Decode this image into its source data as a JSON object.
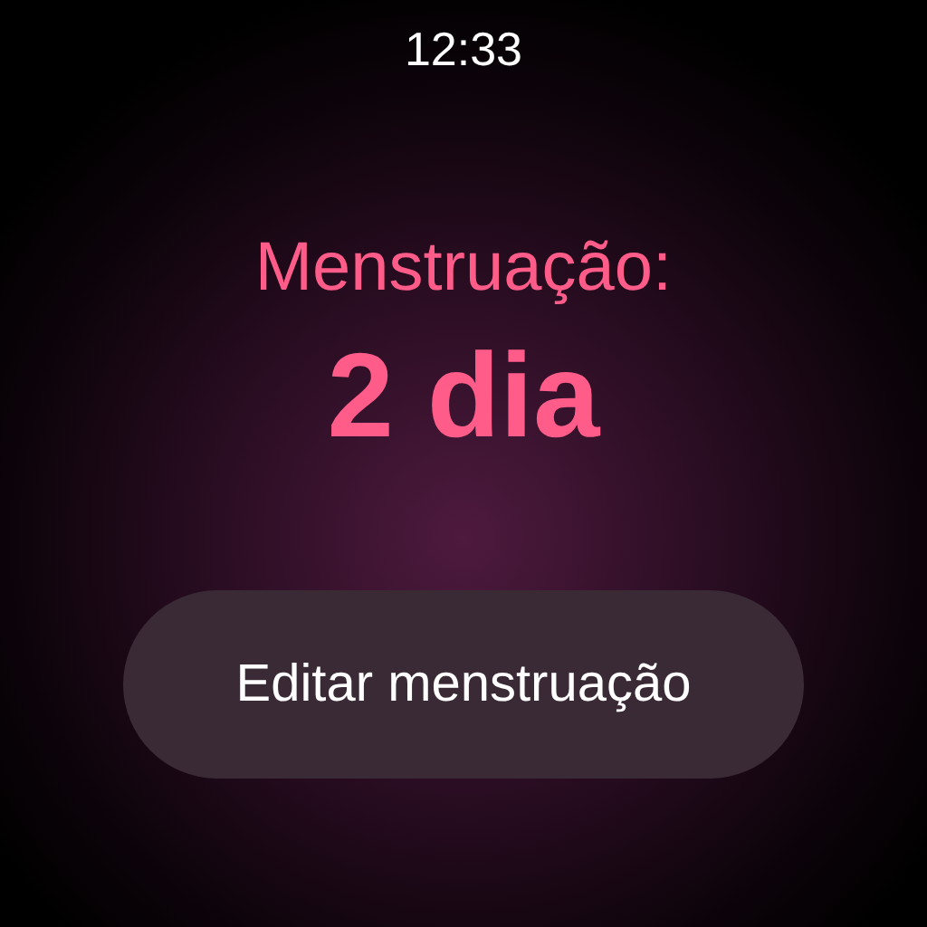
{
  "status_bar": {
    "time": "12:33"
  },
  "label": "Menstruação:",
  "value": "2 dia",
  "button": {
    "label": "Editar menstruação"
  }
}
